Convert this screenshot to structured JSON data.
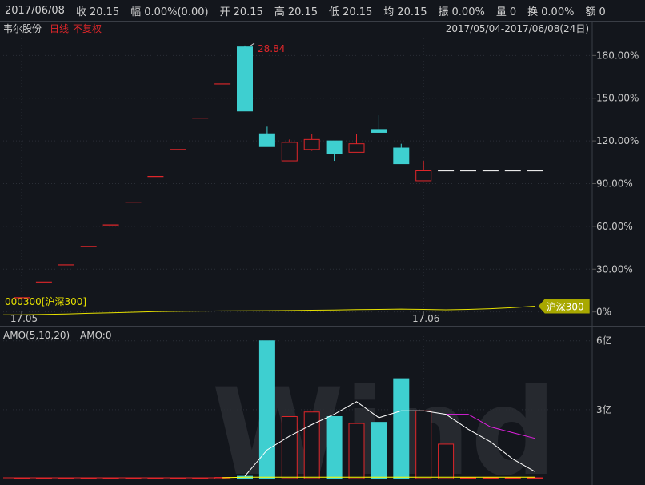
{
  "topbar": {
    "date": "2017/06/08",
    "fields": [
      {
        "label": "收",
        "value": "20.15"
      },
      {
        "label": "幅",
        "value": "0.00%(0.00)"
      },
      {
        "label": "开",
        "value": "20.15"
      },
      {
        "label": "高",
        "value": "20.15"
      },
      {
        "label": "低",
        "value": "20.15"
      },
      {
        "label": "均",
        "value": "20.15"
      },
      {
        "label": "振",
        "value": "0.00%"
      },
      {
        "label": "量",
        "value": "0"
      },
      {
        "label": "换",
        "value": "0.00%"
      },
      {
        "label": "额",
        "value": "0"
      }
    ]
  },
  "colors": {
    "background": "#13161c",
    "up": "#e0262a",
    "down": "#3ecfd0",
    "index_line": "#e6e000",
    "ma5": "#ffffff",
    "ma10": "#ffff00",
    "ma20": "#e020e0",
    "grid": "#2a2e36",
    "index_tag": "#a8a800"
  },
  "chart_data": [
    {
      "type": "candlestick",
      "title": "韦尔股份",
      "period_label": "日线",
      "adjust_label": "不复权",
      "range_label": "2017/05/04-2017/06/08(24日)",
      "ylim": [
        -3,
        192
      ],
      "y_ticks": [
        0,
        30,
        60,
        90,
        120,
        150,
        180
      ],
      "y_tick_labels": [
        "0%",
        "30.00%",
        "60.00%",
        "90.00%",
        "120.00%",
        "150.00%",
        "180.00%"
      ],
      "x_tick_labels": [
        {
          "index": 0,
          "label": "17.05"
        },
        {
          "index": 18,
          "label": "17.06"
        }
      ],
      "max_label": {
        "index": 11,
        "text": "28.84"
      },
      "candles": [
        {
          "o": 10,
          "c": 10,
          "h": 10,
          "l": 10
        },
        {
          "o": 21,
          "c": 21,
          "h": 21,
          "l": 21
        },
        {
          "o": 33,
          "c": 33,
          "h": 33,
          "l": 33
        },
        {
          "o": 46,
          "c": 46,
          "h": 46,
          "l": 46
        },
        {
          "o": 61,
          "c": 61,
          "h": 61,
          "l": 61
        },
        {
          "o": 77,
          "c": 77,
          "h": 77,
          "l": 77
        },
        {
          "o": 95,
          "c": 95,
          "h": 95,
          "l": 95
        },
        {
          "o": 114,
          "c": 114,
          "h": 114,
          "l": 114
        },
        {
          "o": 136,
          "c": 136,
          "h": 136,
          "l": 136
        },
        {
          "o": 160,
          "c": 160,
          "h": 160,
          "l": 160
        },
        {
          "o": 186,
          "c": 141,
          "h": 187,
          "l": 141
        },
        {
          "o": 125,
          "c": 116,
          "h": 130,
          "l": 116
        },
        {
          "o": 106,
          "c": 119,
          "h": 121,
          "l": 106
        },
        {
          "o": 114,
          "c": 121,
          "h": 125,
          "l": 113
        },
        {
          "o": 120,
          "c": 111,
          "h": 120,
          "l": 106
        },
        {
          "o": 112,
          "c": 118,
          "h": 125,
          "l": 112
        },
        {
          "o": 128,
          "c": 126,
          "h": 138,
          "l": 126
        },
        {
          "o": 115,
          "c": 104,
          "h": 118,
          "l": 104
        },
        {
          "o": 92,
          "c": 99,
          "h": 106,
          "l": 92
        },
        {
          "o": 99,
          "c": 99,
          "h": 99,
          "l": 99
        },
        {
          "o": 99,
          "c": 99,
          "h": 99,
          "l": 99
        },
        {
          "o": 99,
          "c": 99,
          "h": 99,
          "l": 99
        },
        {
          "o": 99,
          "c": 99,
          "h": 99,
          "l": 99
        },
        {
          "o": 99,
          "c": 99,
          "h": 99,
          "l": 99
        }
      ],
      "index_series": {
        "name": "000300[沪深300]",
        "tag": "沪深300",
        "values": [
          -2,
          -1.7,
          -1.4,
          -1,
          -0.6,
          -0.2,
          0.2,
          0.4,
          0.6,
          0.7,
          0.8,
          0.9,
          1.0,
          1.2,
          1.4,
          1.6,
          1.8,
          2.0,
          1.8,
          1.5,
          1.8,
          2.3,
          3.0,
          4.0
        ]
      }
    },
    {
      "type": "bar",
      "title": "AMO(5,10,20)",
      "subtitle": "AMO:0",
      "unit_labels": [
        "6亿",
        "3亿"
      ],
      "ylim": [
        0,
        6.2
      ],
      "y_ticks": [
        3,
        6
      ],
      "values": [
        0.02,
        0.02,
        0.02,
        0.02,
        0.02,
        0.02,
        0.02,
        0.02,
        0.02,
        0.05,
        0.1,
        6.0,
        2.7,
        2.9,
        2.7,
        2.4,
        2.45,
        4.35,
        2.95,
        1.5,
        0,
        0,
        0,
        0
      ],
      "ma5": [
        null,
        null,
        null,
        null,
        null,
        null,
        null,
        null,
        null,
        null,
        0.1,
        1.25,
        1.85,
        2.35,
        2.8,
        3.35,
        2.65,
        2.95,
        2.95,
        2.8,
        2.15,
        1.6,
        0.85,
        0.3
      ],
      "ma10": [
        null,
        null,
        null,
        null,
        null,
        null,
        null,
        null,
        null,
        0.04,
        0.06,
        0.06,
        0.06,
        0.06,
        0.06,
        0.06,
        0.06,
        0.06,
        0.06,
        0.06,
        0.06,
        0.06,
        0.06,
        0.06
      ],
      "ma20": [
        null,
        null,
        null,
        null,
        null,
        null,
        null,
        null,
        null,
        null,
        null,
        null,
        null,
        null,
        null,
        null,
        null,
        null,
        null,
        2.8,
        2.8,
        2.25,
        2.0,
        1.75
      ]
    }
  ]
}
